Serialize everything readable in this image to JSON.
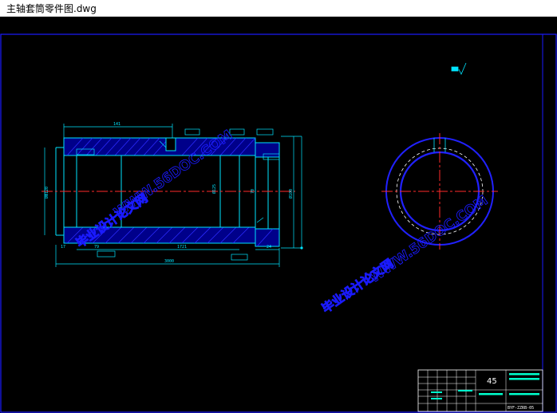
{
  "window": {
    "title": "主轴套筒零件图.dwg"
  },
  "drawing": {
    "material": "45",
    "drawing_number": "BYF-ZZRB-05",
    "watermark_url": "WWW.56DOC.COM",
    "watermark_cn": "毕业设计论文网",
    "dims": {
      "d141": "141",
      "d79": "79",
      "d1725": "1721",
      "d300": "3000",
      "d17": "17",
      "d24": "24",
      "d70": "70",
      "dia_left": "ØФ120",
      "dia_mid": "Ø125",
      "dia_right": "Ø100"
    },
    "colors": {
      "outline": "#00e5ff",
      "hatch": "#0000ff",
      "center": "#ff2a2a",
      "dim": "#00e5ff",
      "frame": "#1a1aff",
      "watermark": "#1414ff"
    }
  }
}
